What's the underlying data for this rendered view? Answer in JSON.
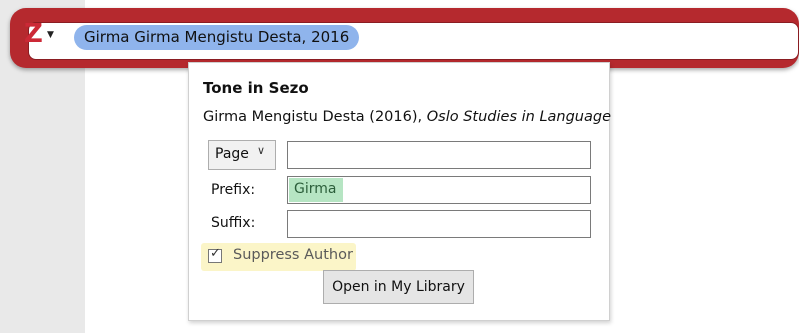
{
  "quick_format": {
    "logo_letter": "Z",
    "citation_bubble": "Girma Girma Mengistu Desta, 2016"
  },
  "panel": {
    "title": "Tone in Sezo",
    "citation_author_year": "Girma Mengistu Desta (2016), ",
    "citation_journal": "Oslo Studies in Language",
    "locator_type": "Page",
    "locator_value": "",
    "prefix_label": "Prefix:",
    "prefix_value": "Girma",
    "suffix_label": "Suffix:",
    "suffix_value": "",
    "suppress_author_label": "Suppress Author",
    "suppress_author_checked": true,
    "open_button_label": "Open in My Library"
  },
  "colors": {
    "bar_red": "#b5292e",
    "bubble_blue": "#8fb4ec",
    "prefix_highlight": "#b6e5c3",
    "suppress_highlight": "#fbf5c8"
  },
  "icons": {
    "logo": "zotero-logo-icon",
    "dropdown": "chevron-down-icon",
    "checkbox": "checkmark-icon"
  }
}
